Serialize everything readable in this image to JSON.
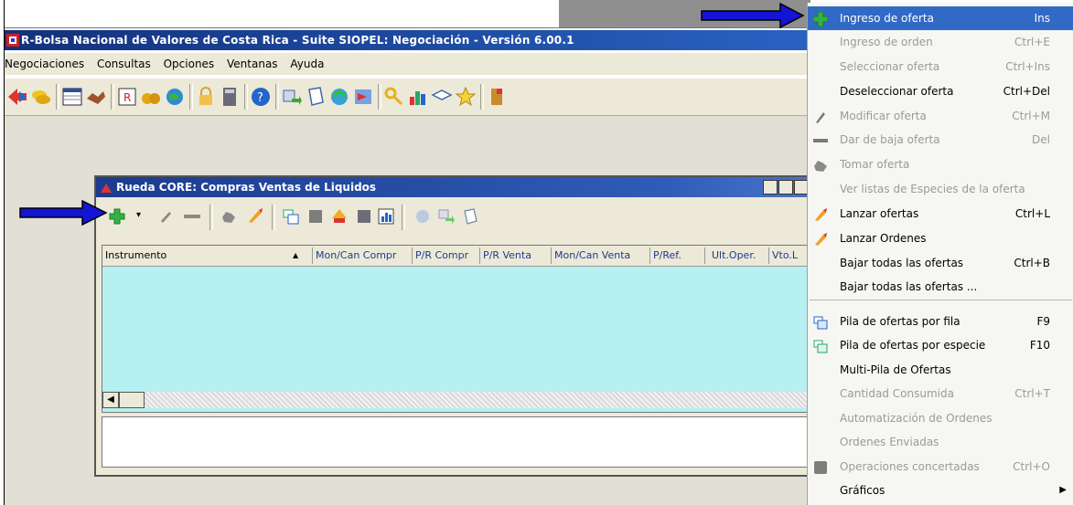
{
  "app": {
    "title": "R-Bolsa Nacional de Valores de Costa Rica - Suite SIOPEL: Negociación - Versión 6.00.1",
    "menu": [
      "Negociaciones",
      "Consultas",
      "Opciones",
      "Ventanas",
      "Ayuda"
    ]
  },
  "inner_window": {
    "title": "Rueda CORE: Compras Ventas de Liquidos",
    "columns": [
      "Instrumento",
      "Mon/Can Compr",
      "P/R Compr",
      "P/R Venta",
      "Mon/Can Venta",
      "P/Ref.",
      "Ult.Oper.",
      "Vto.L"
    ]
  },
  "context_menu": [
    {
      "label": "Ingreso de oferta",
      "shortcut": "Ins",
      "state": "selected",
      "icon": "green-plus-icon"
    },
    {
      "label": "Ingreso de orden",
      "shortcut": "Ctrl+E",
      "state": "disabled",
      "icon": ""
    },
    {
      "label": "Seleccionar oferta",
      "shortcut": "Ctrl+Ins",
      "state": "disabled",
      "icon": ""
    },
    {
      "label": "Deseleccionar oferta",
      "shortcut": "Ctrl+Del",
      "state": "enabled",
      "icon": ""
    },
    {
      "label": "Modificar oferta",
      "shortcut": "Ctrl+M",
      "state": "disabled",
      "icon": "pen-icon"
    },
    {
      "label": "Dar de baja oferta",
      "shortcut": "Del",
      "state": "disabled",
      "icon": "minus-icon"
    },
    {
      "label": "Tomar oferta",
      "shortcut": "",
      "state": "disabled",
      "icon": "hand-icon"
    },
    {
      "label": "Ver listas de Especies de la oferta",
      "shortcut": "",
      "state": "disabled",
      "icon": ""
    },
    {
      "label": "Lanzar ofertas",
      "shortcut": "Ctrl+L",
      "state": "enabled",
      "icon": "rocket-icon"
    },
    {
      "label": "Lanzar Ordenes",
      "shortcut": "",
      "state": "enabled",
      "icon": "rocket-icon"
    },
    {
      "label": "Bajar todas las ofertas",
      "shortcut": "Ctrl+B",
      "state": "enabled",
      "icon": ""
    },
    {
      "label": "Bajar todas las ofertas ...",
      "shortcut": "",
      "state": "enabled",
      "icon": ""
    },
    {
      "label": "Pila de ofertas por fila",
      "shortcut": "F9",
      "state": "enabled",
      "icon": "stack-icon"
    },
    {
      "label": "Pila de ofertas por especie",
      "shortcut": "F10",
      "state": "enabled",
      "icon": "stack-green-icon"
    },
    {
      "label": "Multi-Pila de Ofertas",
      "shortcut": "",
      "state": "enabled",
      "icon": ""
    },
    {
      "label": "Cantidad Consumida",
      "shortcut": "Ctrl+T",
      "state": "disabled",
      "icon": ""
    },
    {
      "label": "Automatización de Ordenes",
      "shortcut": "",
      "state": "disabled",
      "icon": ""
    },
    {
      "label": "Ordenes Enviadas",
      "shortcut": "",
      "state": "disabled",
      "icon": ""
    },
    {
      "label": "Operaciones concertadas",
      "shortcut": "Ctrl+O",
      "state": "disabled",
      "icon": "gray-square-icon"
    },
    {
      "label": "Gráficos",
      "shortcut": "",
      "state": "enabled",
      "icon": "",
      "submenu": true
    }
  ],
  "colors": {
    "selected": "#316ac5",
    "title": "#1f4fa8",
    "grid": "#b6f0f0",
    "arrow": "#1414d4"
  }
}
